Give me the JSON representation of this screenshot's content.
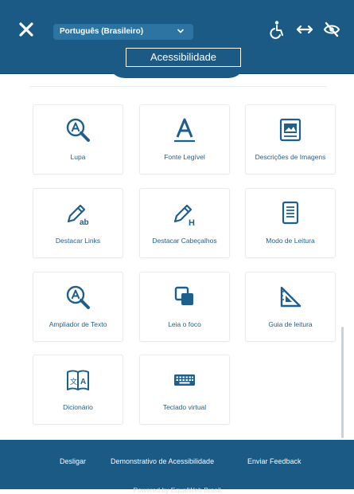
{
  "header": {
    "language": "Português (Brasileiro)",
    "title": "Acessibilidade"
  },
  "icons": {
    "close": "close-icon",
    "lang_dropdown": "chevron-down-icon",
    "accessibility": "accessibility-person-icon",
    "resize": "horizontal-arrows-icon",
    "hide": "eye-slash-icon"
  },
  "tools": [
    {
      "label": "Lupa",
      "icon": "magnifier-a-icon"
    },
    {
      "label": "Fonte Legível",
      "icon": "font-a-icon"
    },
    {
      "label": "Descrições de Imagens",
      "icon": "image-icon"
    },
    {
      "label": "Destacar Links",
      "icon": "pencil-link-icon"
    },
    {
      "label": "Destacar Cabeçalhos",
      "icon": "pencil-heading-icon"
    },
    {
      "label": "Modo de Leitura",
      "icon": "document-icon"
    },
    {
      "label": "Ampliador de Texto",
      "icon": "magnifier-a-icon"
    },
    {
      "label": "Leia o foco",
      "icon": "focus-squares-icon"
    },
    {
      "label": "Guia de leitura",
      "icon": "reading-guide-icon"
    },
    {
      "label": "Dicionário",
      "icon": "dictionary-book-icon"
    },
    {
      "label": "Teclado virtual",
      "icon": "keyboard-icon"
    }
  ],
  "footer": {
    "links": [
      "Desligar",
      "Demonstrativo de Acessibilidade",
      "Enviar Feedback"
    ],
    "powered": "Powered by EqualWeb Brasil"
  },
  "colors": {
    "primary": "#1a5a85",
    "icon": "#1f5f8b",
    "tile_border": "#e8ecef"
  }
}
